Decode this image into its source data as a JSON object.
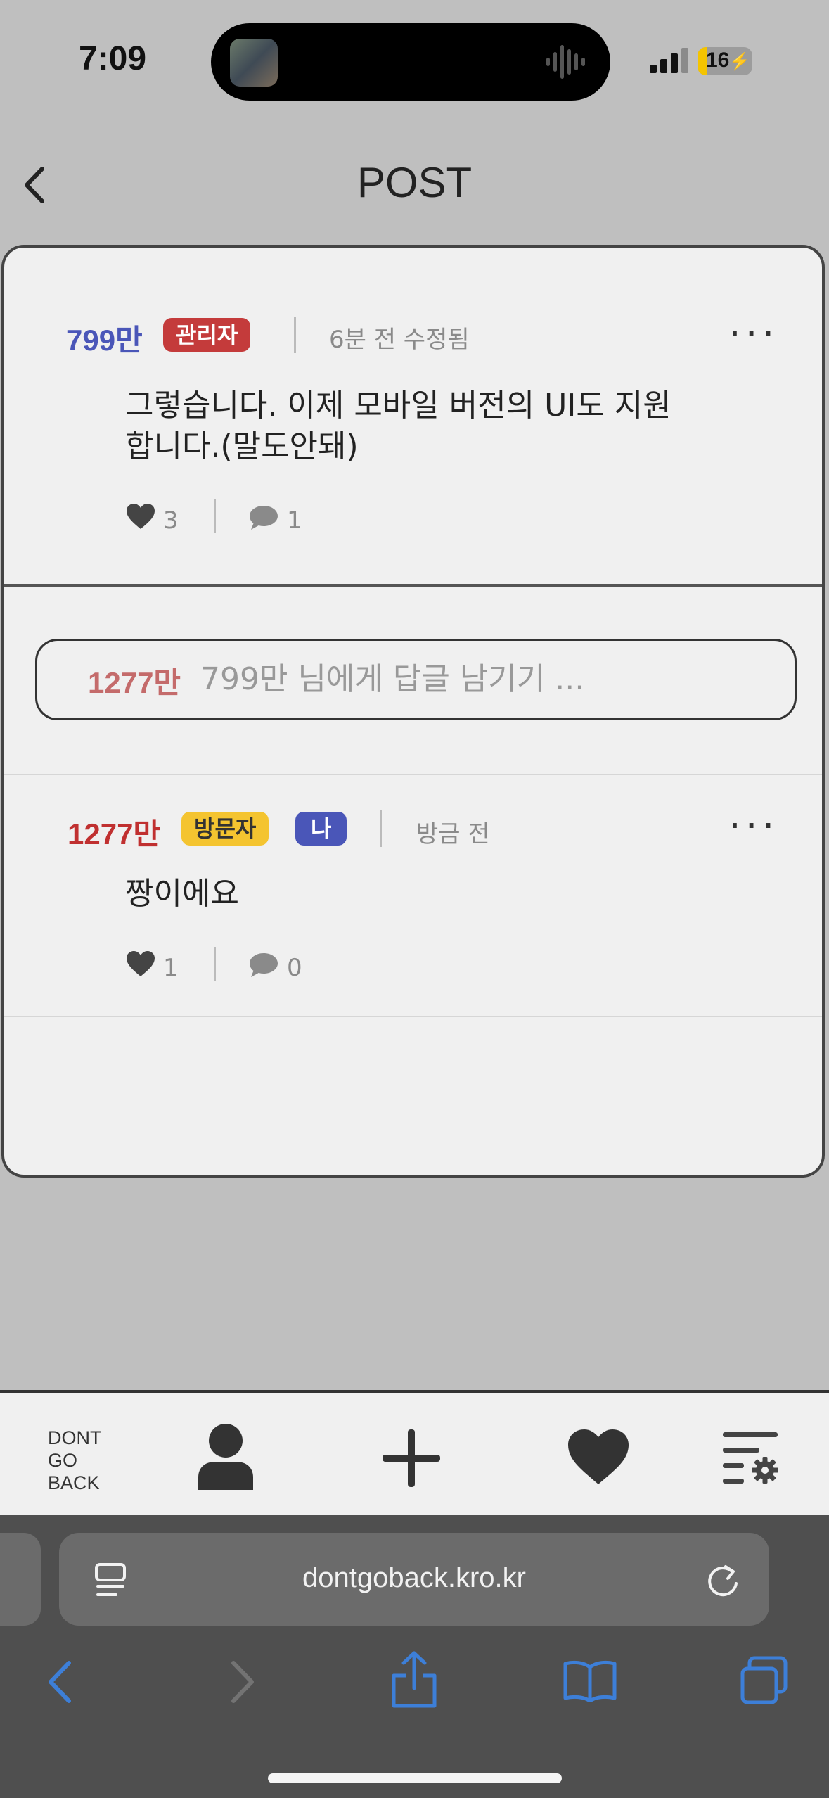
{
  "status_bar": {
    "time": "7:09",
    "battery": "16"
  },
  "header": {
    "title": "POST"
  },
  "post": {
    "author": "799만",
    "role_badge": "관리자",
    "timestamp": "6분 전 수정됨",
    "more": "···",
    "content_lines": [
      "그렇습니다. 이제 모바일 버전의 UI도 지원",
      "합니다.(말도안돼)"
    ],
    "likes": "3",
    "comments": "1"
  },
  "reply_form": {
    "user": "1277만",
    "placeholder": "799만 님에게 답글 남기기 ..."
  },
  "comments": [
    {
      "author": "1277만",
      "role_badge": "방문자",
      "me_badge": "나",
      "timestamp": "방금 전",
      "more": "···",
      "content": "짱이에요",
      "likes": "1",
      "comments": "0"
    }
  ],
  "app_nav": {
    "logo_lines": [
      "DONT",
      "GO",
      "BACK"
    ],
    "icons": [
      "profile-icon",
      "plus-icon",
      "heart-icon",
      "settings-menu-icon"
    ]
  },
  "browser": {
    "url": "dontgoback.kro.kr"
  },
  "colors": {
    "admin_name": "#4a56b8",
    "admin_badge": "#c43b3b",
    "visitor_name": "#c03030",
    "visitor_badge": "#f4c430",
    "me_badge": "#4a56b8",
    "safari_blue": "#3d7fd8"
  }
}
